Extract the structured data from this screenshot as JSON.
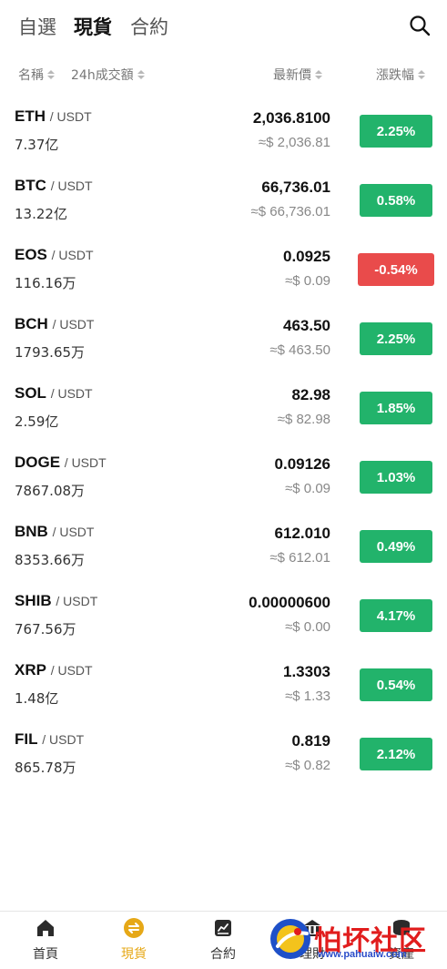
{
  "top_tabs": [
    {
      "label": "自選",
      "active": false
    },
    {
      "label": "現貨",
      "active": true
    },
    {
      "label": "合約",
      "active": false
    }
  ],
  "columns": {
    "name": "名稱",
    "volume": "24h成交額",
    "price": "最新價",
    "change": "漲跌幅"
  },
  "quote_separator": "/ USDT",
  "rows": [
    {
      "base": "ETH",
      "quote": "/ USDT",
      "volume": "7.37亿",
      "price": "2,036.8100",
      "fiat": "≈$ 2,036.81",
      "change": "2.25%",
      "direction": "up"
    },
    {
      "base": "BTC",
      "quote": "/ USDT",
      "volume": "13.22亿",
      "price": "66,736.01",
      "fiat": "≈$ 66,736.01",
      "change": "0.58%",
      "direction": "up"
    },
    {
      "base": "EOS",
      "quote": "/ USDT",
      "volume": "116.16万",
      "price": "0.0925",
      "fiat": "≈$ 0.09",
      "change": "-0.54%",
      "direction": "down"
    },
    {
      "base": "BCH",
      "quote": "/ USDT",
      "volume": "1793.65万",
      "price": "463.50",
      "fiat": "≈$ 463.50",
      "change": "2.25%",
      "direction": "up"
    },
    {
      "base": "SOL",
      "quote": "/ USDT",
      "volume": "2.59亿",
      "price": "82.98",
      "fiat": "≈$ 82.98",
      "change": "1.85%",
      "direction": "up"
    },
    {
      "base": "DOGE",
      "quote": "/ USDT",
      "volume": "7867.08万",
      "price": "0.09126",
      "fiat": "≈$ 0.09",
      "change": "1.03%",
      "direction": "up"
    },
    {
      "base": "BNB",
      "quote": "/ USDT",
      "volume": "8353.66万",
      "price": "612.010",
      "fiat": "≈$ 612.01",
      "change": "0.49%",
      "direction": "up"
    },
    {
      "base": "SHIB",
      "quote": "/ USDT",
      "volume": "767.56万",
      "price": "0.00000600",
      "fiat": "≈$ 0.00",
      "change": "4.17%",
      "direction": "up"
    },
    {
      "base": "XRP",
      "quote": "/ USDT",
      "volume": "1.48亿",
      "price": "1.3303",
      "fiat": "≈$ 1.33",
      "change": "0.54%",
      "direction": "up"
    },
    {
      "base": "FIL",
      "quote": "/ USDT",
      "volume": "865.78万",
      "price": "0.819",
      "fiat": "≈$ 0.82",
      "change": "2.12%",
      "direction": "up"
    }
  ],
  "bottom_nav": [
    {
      "label": "首頁",
      "icon": "home-icon",
      "active": false
    },
    {
      "label": "現貨",
      "icon": "swap-icon",
      "active": true
    },
    {
      "label": "合約",
      "icon": "chart-icon",
      "active": false
    },
    {
      "label": "理財",
      "icon": "finance-icon",
      "active": false
    },
    {
      "label": "資產",
      "icon": "wallet-icon",
      "active": false
    }
  ],
  "watermark": {
    "text": "怕坏社区",
    "url": "www.pahuaiw.com"
  },
  "colors": {
    "up": "#22b36b",
    "down": "#e94b4b",
    "accent": "#e6a817"
  }
}
